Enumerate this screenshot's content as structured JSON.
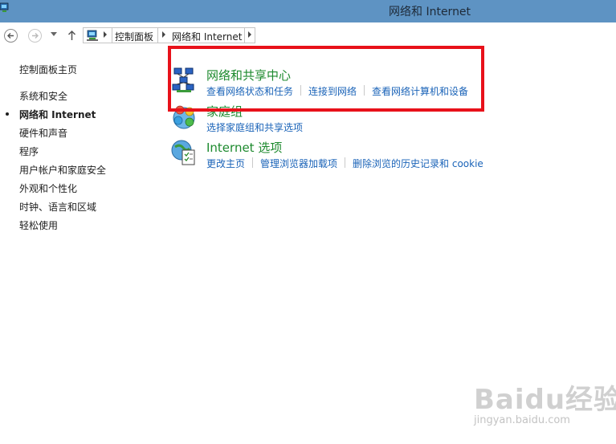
{
  "window": {
    "title": "网络和 Internet",
    "icon": "control-panel-icon"
  },
  "nav": {
    "back_icon": "back-arrow-icon",
    "forward_icon": "forward-arrow-icon",
    "recent_icon": "chevron-down-icon",
    "up_icon": "up-arrow-icon",
    "breadcrumb": [
      "控制面板",
      "网络和 Internet"
    ]
  },
  "sidebar": {
    "items": [
      {
        "label": "控制面板主页"
      },
      {
        "label": "系统和安全"
      },
      {
        "label": "网络和 Internet",
        "active": true
      },
      {
        "label": "硬件和声音"
      },
      {
        "label": "程序"
      },
      {
        "label": "用户帐户和家庭安全"
      },
      {
        "label": "外观和个性化"
      },
      {
        "label": "时钟、语言和区域"
      },
      {
        "label": "轻松使用"
      }
    ]
  },
  "categories": [
    {
      "heading": "网络和共享中心",
      "icon": "network-sharing-center-icon",
      "links": [
        "查看网络状态和任务",
        "连接到网络",
        "查看网络计算机和设备"
      ]
    },
    {
      "heading": "家庭组",
      "icon": "homegroup-icon",
      "links": [
        "选择家庭组和共享选项"
      ]
    },
    {
      "heading": "Internet 选项",
      "icon": "internet-options-icon",
      "links": [
        "更改主页",
        "管理浏览器加载项",
        "删除浏览的历史记录和 cookie"
      ]
    }
  ],
  "highlight_color": "#e8111a",
  "colors": {
    "titlebar": "#5e93c3",
    "heading": "#1d8a2e",
    "link": "#1a63b8"
  },
  "watermark": {
    "main": "Baidu经验",
    "sub": "jingyan.baidu.com"
  }
}
